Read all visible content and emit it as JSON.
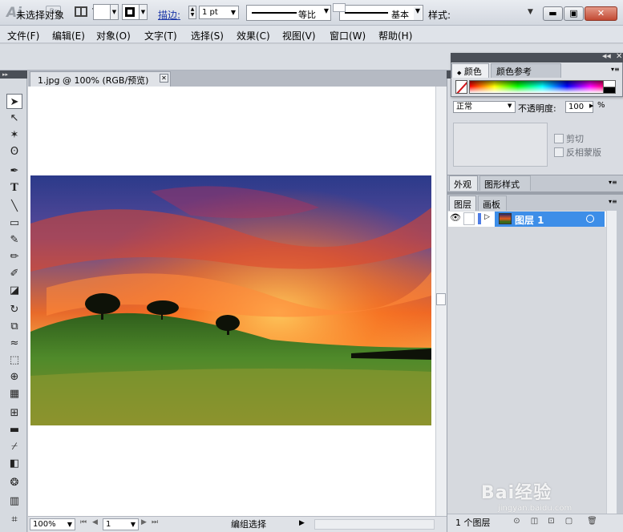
{
  "app": {
    "logo_text": "Ai",
    "bridge_label": "Br"
  },
  "window_buttons": {
    "minimize": "▬",
    "maximize": "▣",
    "close": "✕"
  },
  "menu": [
    "文件(F)",
    "编辑(E)",
    "对象(O)",
    "文字(T)",
    "选择(S)",
    "效果(C)",
    "视图(V)",
    "窗口(W)",
    "帮助(H)"
  ],
  "control_bar": {
    "selection_status": "未选择对象",
    "stroke_label": "描边:",
    "stroke_weight": "1 pt",
    "profile_label": "等比",
    "brush_label": "基本",
    "style_label": "样式:"
  },
  "document": {
    "tab_title": "1.jpg @ 100% (RGB/预览)",
    "zoom": "100%",
    "artboard_number": "1",
    "status_text": "编组选择"
  },
  "color_panel": {
    "tabs": [
      "颜色",
      "颜色参考"
    ],
    "active_tab": "颜色"
  },
  "transparency_panel": {
    "blend_mode": "正常",
    "opacity_label": "不透明度:",
    "opacity_value": "100",
    "opacity_unit": "%",
    "clip_label": "剪切",
    "invert_mask_label": "反相蒙版"
  },
  "appearance_panel": {
    "tabs": [
      "外观",
      "图形样式"
    ]
  },
  "layers_panel": {
    "tabs": [
      "图层",
      "画板"
    ],
    "layers": [
      {
        "name": "图层 1",
        "selected": true,
        "color": "#4d7ce5"
      }
    ],
    "count_label": "1 个图层"
  },
  "watermark": {
    "text": "Bai经验",
    "url": "jingyan.baidu.com"
  },
  "icons": {
    "tools": [
      "selection-tool",
      "direct-selection-tool",
      "magic-wand-tool",
      "lasso-tool",
      "pen-tool",
      "type-tool",
      "line-segment-tool",
      "rectangle-tool",
      "paintbrush-tool",
      "pencil-tool",
      "blob-brush-tool",
      "eraser-tool",
      "rotate-tool",
      "scale-tool",
      "warp-tool",
      "free-transform-tool",
      "shape-builder-tool",
      "perspective-grid-tool",
      "mesh-tool",
      "gradient-tool",
      "eyedropper-tool",
      "blend-tool",
      "symbol-sprayer-tool",
      "column-graph-tool",
      "artboard-tool"
    ]
  }
}
